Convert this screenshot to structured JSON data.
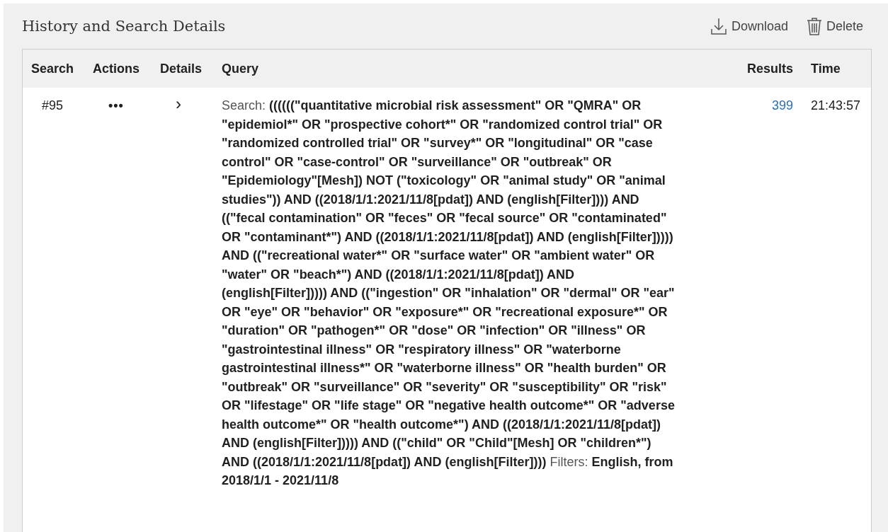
{
  "panel": {
    "title": "History and Search Details",
    "actions": [
      {
        "kind": "download",
        "label": "Download"
      },
      {
        "kind": "delete",
        "label": "Delete"
      }
    ]
  },
  "table": {
    "columns": [
      "Search",
      "Actions",
      "Details",
      "Query",
      "Results",
      "Time"
    ],
    "rows": [
      {
        "search": "#95",
        "actions": "•••",
        "details": "›",
        "query_label": "Search:",
        "query": "((((((\"quantitative microbial risk assessment\" OR \"QMRA\" OR \"epidemiol*\" OR \"prospective cohort*\" OR \"randomized control trial\" OR \"randomized controlled trial\" OR \"survey*\" OR \"longitudinal\" OR \"case control\" OR \"case-control\" OR \"surveillance\" OR \"outbreak\" OR \"Epidemiology\"[Mesh]) NOT (\"toxicology\" OR \"animal study\" OR \"animal studies\")) AND ((2018/1/1:2021/11/8[pdat]) AND (english[Filter]))) AND ((\"fecal contamination\" OR \"feces\" OR \"fecal source\" OR \"contaminated\" OR \"contaminant*\") AND ((2018/1/1:2021/11/8[pdat]) AND (english[Filter])))) AND ((\"recreational water*\" OR \"surface water\" OR \"ambient water\" OR \"water\" OR \"beach*\") AND ((2018/1/1:2021/11/8[pdat]) AND (english[Filter])))) AND ((\"ingestion\" OR \"inhalation\" OR \"dermal\" OR \"ear\" OR \"eye\" OR \"behavior\" OR \"exposure*\" OR \"recreational exposure*\" OR \"duration\" OR \"pathogen*\" OR \"dose\" OR \"infection\" OR \"illness\" OR \"gastrointestinal illness\" OR \"respiratory illness\" OR \"waterborne gastrointestinal illness*\" OR \"waterborne illness\" OR \"health burden\" OR \"outbreak\" OR \"surveillance\" OR \"severity\" OR \"susceptibility\" OR \"risk\" OR \"lifestage\" OR \"life stage\" OR \"negative health outcome*\" OR \"adverse health outcome*\" OR \"health outcome*\") AND ((2018/1/1:2021/11/8[pdat]) AND (english[Filter])))) AND ((\"child\" OR \"Child\"[Mesh] OR \"children*\") AND ((2018/1/1:2021/11/8[pdat]) AND (english[Filter])))",
        "filters_label": "Filters:",
        "filters": "English, from 2018/1/1 - 2021/11/8",
        "results": "399",
        "time": "21:43:57"
      }
    ]
  }
}
